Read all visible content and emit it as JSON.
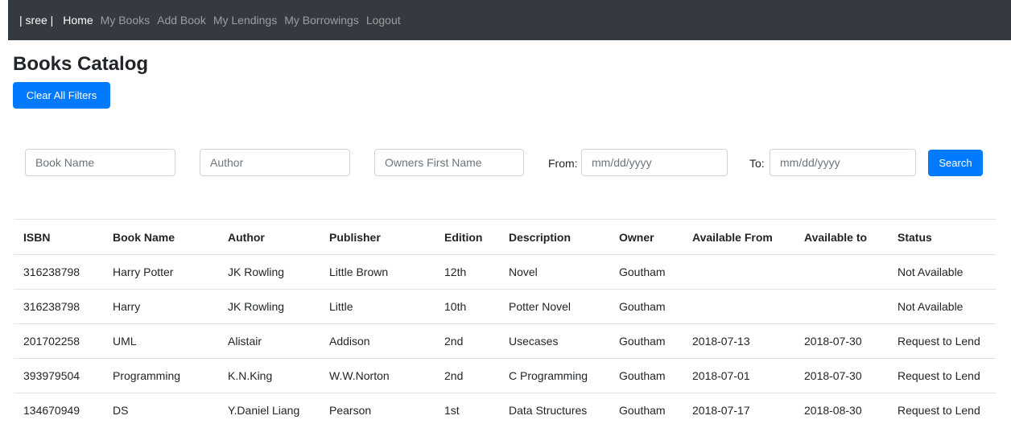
{
  "nav": {
    "brand": "| sree |",
    "links": [
      "Home",
      "My Books",
      "Add Book",
      "My Lendings",
      "My Borrowings",
      "Logout"
    ]
  },
  "page": {
    "title": "Books Catalog",
    "clear_filters_label": "Clear All Filters"
  },
  "filters": {
    "book_name_placeholder": "Book Name",
    "author_placeholder": "Author",
    "owner_placeholder": "Owners First Name",
    "from_label": "From:",
    "from_placeholder": "mm/dd/yyyy",
    "to_label": "To:",
    "to_placeholder": "mm/dd/yyyy",
    "search_label": "Search"
  },
  "table": {
    "headers": [
      "ISBN",
      "Book Name",
      "Author",
      "Publisher",
      "Edition",
      "Description",
      "Owner",
      "Available From",
      "Available to",
      "Status"
    ],
    "rows": [
      [
        "316238798",
        "Harry Potter",
        "JK Rowling",
        "Little Brown",
        "12th",
        "Novel",
        "Goutham",
        "",
        "",
        "Not Available"
      ],
      [
        "316238798",
        "Harry",
        "JK Rowling",
        "Little",
        "10th",
        "Potter Novel",
        "Goutham",
        "",
        "",
        "Not Available"
      ],
      [
        "201702258",
        "UML",
        "Alistair",
        "Addison",
        "2nd",
        "Usecases",
        "Goutham",
        "2018-07-13",
        "2018-07-30",
        "Request to Lend"
      ],
      [
        "393979504",
        "Programming",
        "K.N.King",
        "W.W.Norton",
        "2nd",
        "C Programming",
        "Goutham",
        "2018-07-01",
        "2018-07-30",
        "Request to Lend"
      ],
      [
        "134670949",
        "DS",
        "Y.Daniel Liang",
        "Pearson",
        "1st",
        "Data Structures",
        "Goutham",
        "2018-07-17",
        "2018-08-30",
        "Request to Lend"
      ]
    ]
  },
  "colors": {
    "navbar_bg": "#343a40",
    "primary": "#007bff",
    "danger": "#dc3545"
  }
}
